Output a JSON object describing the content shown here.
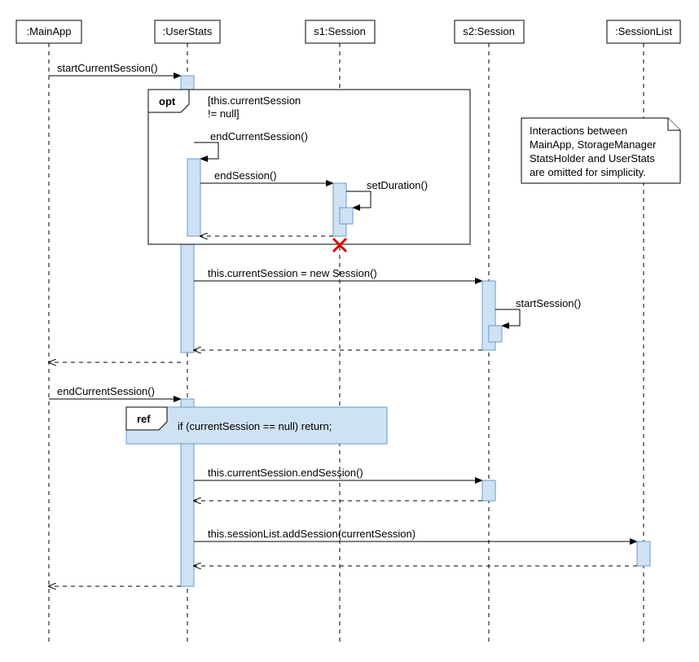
{
  "lifelines": {
    "mainapp": ":MainApp",
    "userstats": ":UserStats",
    "s1": "s1:Session",
    "s2": "s2:Session",
    "sessionlist": ":SessionList"
  },
  "messages": {
    "startCurrentSession": "startCurrentSession()",
    "endCurrentSession": "endCurrentSession()",
    "endSession": "endSession()",
    "setDuration": "setDuration()",
    "newSession": "this.currentSession = new Session()",
    "startSession": "startSession()",
    "endCurrentSession2": "endCurrentSession()",
    "currentSessionEnd": "this.currentSession.endSession()",
    "addSession": "this.sessionList.addSession(currentSession)"
  },
  "fragments": {
    "opt_label": "opt",
    "opt_guard_l1": "[this.currentSession",
    "opt_guard_l2": "!= null]",
    "ref_label": "ref",
    "ref_text": "if (currentSession == null) return;"
  },
  "note": {
    "l1": "Interactions between",
    "l2": "MainApp, StorageManager",
    "l3": "StatsHolder and UserStats",
    "l4": "are omitted for simplicity."
  }
}
